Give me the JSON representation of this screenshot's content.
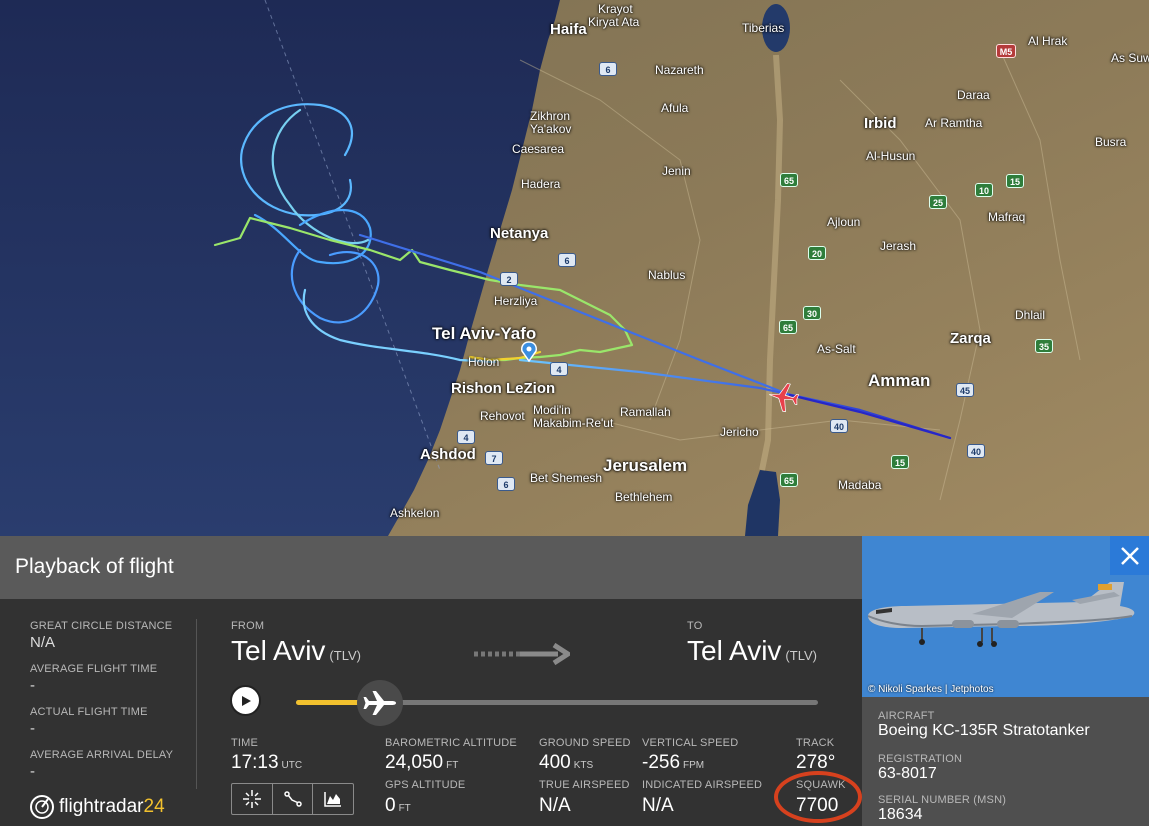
{
  "map": {
    "cities": [
      {
        "name": "Krayot",
        "size": "n"
      },
      {
        "name": "Kiryat Ata",
        "size": "n"
      },
      {
        "name": "Haifa",
        "size": "big"
      },
      {
        "name": "Tiberias",
        "size": "n"
      },
      {
        "name": "Nazareth",
        "size": "n"
      },
      {
        "name": "Afula",
        "size": "n"
      },
      {
        "name": "Zikhron Ya'akov",
        "size": "n"
      },
      {
        "name": "Caesarea",
        "size": "n"
      },
      {
        "name": "Hadera",
        "size": "n"
      },
      {
        "name": "Jenin",
        "size": "n"
      },
      {
        "name": "Netanya",
        "size": "big"
      },
      {
        "name": "Nablus",
        "size": "n"
      },
      {
        "name": "Herzliya",
        "size": "n"
      },
      {
        "name": "Tel Aviv-Yafo",
        "size": "xl"
      },
      {
        "name": "Holon",
        "size": "n"
      },
      {
        "name": "Rishon LeZion",
        "size": "big"
      },
      {
        "name": "Rehovot",
        "size": "n"
      },
      {
        "name": "Modi'in Makabim-Re'ut",
        "size": "n"
      },
      {
        "name": "Ramallah",
        "size": "n"
      },
      {
        "name": "Jericho",
        "size": "n"
      },
      {
        "name": "Ashdod",
        "size": "big"
      },
      {
        "name": "Jerusalem",
        "size": "xl"
      },
      {
        "name": "Bet Shemesh",
        "size": "n"
      },
      {
        "name": "Bethlehem",
        "size": "n"
      },
      {
        "name": "Ashkelon",
        "size": "n"
      },
      {
        "name": "Irbid",
        "size": "big"
      },
      {
        "name": "Ar Ramtha",
        "size": "n"
      },
      {
        "name": "Al-Husun",
        "size": "n"
      },
      {
        "name": "Daraa",
        "size": "n"
      },
      {
        "name": "Al Hrak",
        "size": "n"
      },
      {
        "name": "As Suw",
        "size": "n"
      },
      {
        "name": "Busra",
        "size": "n"
      },
      {
        "name": "Mafraq",
        "size": "n"
      },
      {
        "name": "Ajloun",
        "size": "n"
      },
      {
        "name": "Jerash",
        "size": "n"
      },
      {
        "name": "Dhlail",
        "size": "n"
      },
      {
        "name": "Zarqa",
        "size": "big"
      },
      {
        "name": "As-Salt",
        "size": "n"
      },
      {
        "name": "Amman",
        "size": "xl"
      },
      {
        "name": "Madaba",
        "size": "n"
      }
    ],
    "shields": [
      {
        "num": "6",
        "kind": "blue"
      },
      {
        "num": "2",
        "kind": "blue"
      },
      {
        "num": "6",
        "kind": "blue"
      },
      {
        "num": "4",
        "kind": "blue"
      },
      {
        "num": "7",
        "kind": "blue"
      },
      {
        "num": "6",
        "kind": "blue"
      },
      {
        "num": "4",
        "kind": "blue"
      },
      {
        "num": "65",
        "kind": "green"
      },
      {
        "num": "65",
        "kind": "green"
      },
      {
        "num": "65",
        "kind": "green"
      },
      {
        "num": "20",
        "kind": "green"
      },
      {
        "num": "30",
        "kind": "green"
      },
      {
        "num": "10",
        "kind": "green"
      },
      {
        "num": "15",
        "kind": "green"
      },
      {
        "num": "25",
        "kind": "green"
      },
      {
        "num": "15",
        "kind": "green"
      },
      {
        "num": "35",
        "kind": "green"
      },
      {
        "num": "45",
        "kind": "blue"
      },
      {
        "num": "40",
        "kind": "blue"
      },
      {
        "num": "40",
        "kind": "blue"
      },
      {
        "num": "M5",
        "kind": "red"
      }
    ]
  },
  "panel": {
    "title": "Playback of flight",
    "stats": [
      {
        "label": "GREAT CIRCLE DISTANCE",
        "value": "N/A"
      },
      {
        "label": "AVERAGE FLIGHT TIME",
        "value": "-"
      },
      {
        "label": "ACTUAL FLIGHT TIME",
        "value": "-"
      },
      {
        "label": "AVERAGE ARRIVAL DELAY",
        "value": "-"
      }
    ],
    "from": {
      "label": "FROM",
      "city": "Tel Aviv",
      "code": "(TLV)"
    },
    "to": {
      "label": "TO",
      "city": "Tel Aviv",
      "code": "(TLV)"
    },
    "playback_progress": 0.16,
    "time": {
      "label": "TIME",
      "value": "17:13",
      "unit": "UTC"
    },
    "baro_alt": {
      "label": "BAROMETRIC ALTITUDE",
      "value": "24,050",
      "unit": "FT"
    },
    "gps_alt": {
      "label": "GPS ALTITUDE",
      "value": "0",
      "unit": "FT"
    },
    "ground_speed": {
      "label": "GROUND SPEED",
      "value": "400",
      "unit": "KTS"
    },
    "true_airspeed": {
      "label": "TRUE AIRSPEED",
      "value": "N/A"
    },
    "vertical_speed": {
      "label": "VERTICAL SPEED",
      "value": "-256",
      "unit": "FPM"
    },
    "indicated_airspeed": {
      "label": "INDICATED AIRSPEED",
      "value": "N/A"
    },
    "track": {
      "label": "TRACK",
      "value": "278°"
    },
    "squawk": {
      "label": "SQUAWK",
      "value": "7700"
    },
    "logo": {
      "text": "flightradar",
      "num": "24"
    }
  },
  "aircraft": {
    "photo_credit": "© Nikoli Sparkes | Jetphotos",
    "aircraft_label": "AIRCRAFT",
    "aircraft_value": "Boeing KC-135R Stratotanker",
    "registration_label": "REGISTRATION",
    "registration_value": "63-8017",
    "serial_label": "SERIAL NUMBER (MSN)",
    "serial_value": "18634"
  },
  "colors": {
    "accent": "#f2c12e",
    "squawk_ring": "#d6411e",
    "close_button": "#2b7ad8"
  }
}
